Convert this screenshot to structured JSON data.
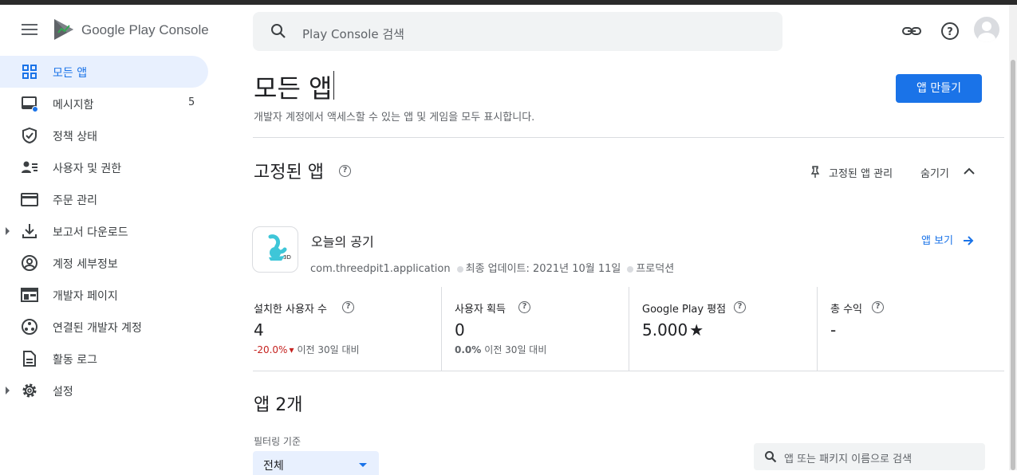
{
  "header": {
    "brand": "Google Play Console",
    "search_placeholder": "Play Console 검색",
    "icons": [
      "menu-icon",
      "link-icon",
      "help-icon",
      "account-icon"
    ]
  },
  "sidebar": {
    "items": [
      {
        "label": "모든 앱",
        "icon": "apps-grid-icon",
        "active": true
      },
      {
        "label": "메시지함",
        "icon": "inbox-icon",
        "count": "5"
      },
      {
        "label": "정책 상태",
        "icon": "shield-icon"
      },
      {
        "label": "사용자 및 권한",
        "icon": "users-icon"
      },
      {
        "label": "주문 관리",
        "icon": "credit-card-icon"
      },
      {
        "label": "보고서 다운로드",
        "icon": "download-icon",
        "expandable": true
      },
      {
        "label": "계정 세부정보",
        "icon": "account-circle-icon"
      },
      {
        "label": "개발자 페이지",
        "icon": "web-page-icon"
      },
      {
        "label": "연결된 개발자 계정",
        "icon": "linked-accounts-icon"
      },
      {
        "label": "활동 로그",
        "icon": "document-icon"
      },
      {
        "label": "설정",
        "icon": "settings-gear-icon",
        "expandable": true
      }
    ]
  },
  "main": {
    "title": "모든 앱",
    "subtitle": "개발자 계정에서 액세스할 수 있는 앱 및 게임을 모두 표시합니다.",
    "create_button": "앱 만들기",
    "pinned": {
      "title": "고정된 앱",
      "manage_label": "고정된 앱 관리",
      "hide_label": "숨기기",
      "app": {
        "name": "오늘의 공기",
        "package": "com.threedpit1.application",
        "updated": "최종 업데이트: 2021년 10월 11일",
        "status": "프로덕션",
        "view_label": "앱 보기"
      },
      "stats": [
        {
          "label": "설치한 사용자 수",
          "value": "4",
          "change": "-20.0%",
          "change_suffix": "이전 30일 대비",
          "change_color": "#c5221f"
        },
        {
          "label": "사용자 획득",
          "value": "0",
          "change": "0.0%",
          "change_suffix": "이전 30일 대비",
          "change_color": "#5f6368"
        },
        {
          "label": "Google Play 평점",
          "value": "5.000",
          "change": "",
          "change_suffix": ""
        },
        {
          "label": "총 수익",
          "value": "-",
          "change": "",
          "change_suffix": ""
        }
      ]
    },
    "apps_count_title": "앱 2개",
    "filter": {
      "label": "필터링 기준",
      "value": "전체"
    },
    "app_search_placeholder": "앱 또는 패키지 이름으로 검색"
  },
  "colors": {
    "accent": "#1a73e8",
    "active_bg": "#e8f0fe",
    "negative": "#c5221f"
  }
}
